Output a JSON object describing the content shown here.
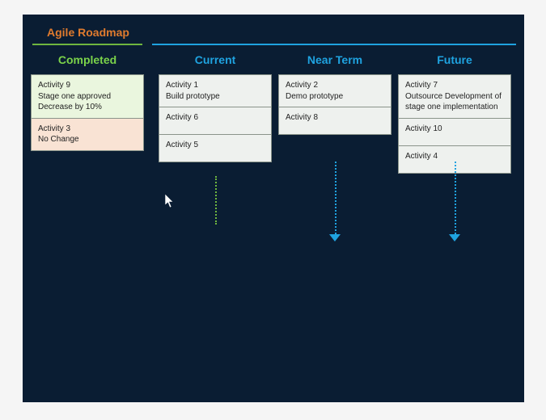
{
  "title": "Agile Roadmap",
  "columns": {
    "completed": {
      "header": "Completed",
      "cards": [
        {
          "title": "Activity 9",
          "desc": "Stage one approved\nDecrease by 10%",
          "tone": "green"
        },
        {
          "title": "Activity 3",
          "desc": "No Change",
          "tone": "peach"
        }
      ]
    },
    "current": {
      "header": "Current",
      "cards": [
        {
          "title": "Activity 1",
          "desc": "Build prototype",
          "tone": "plain"
        },
        {
          "title": "Activity 6",
          "desc": "",
          "tone": "plain"
        },
        {
          "title": "Activity 5",
          "desc": "",
          "tone": "plain"
        }
      ]
    },
    "nearterm": {
      "header": "Near Term",
      "cards": [
        {
          "title": "Activity 2",
          "desc": "Demo prototype",
          "tone": "plain"
        },
        {
          "title": "Activity 8",
          "desc": "",
          "tone": "plain"
        }
      ]
    },
    "future": {
      "header": "Future",
      "cards": [
        {
          "title": "Activity 7",
          "desc": "Outsource Development of stage one implementation",
          "tone": "plain"
        },
        {
          "title": "Activity 10",
          "desc": "",
          "tone": "plain"
        },
        {
          "title": "Activity 4",
          "desc": "",
          "tone": "plain"
        }
      ]
    }
  },
  "colors": {
    "board_bg": "#0a1d33",
    "title": "#e07b2e",
    "completed_accent": "#6fb63f",
    "lane_accent": "#1fa3e0"
  }
}
